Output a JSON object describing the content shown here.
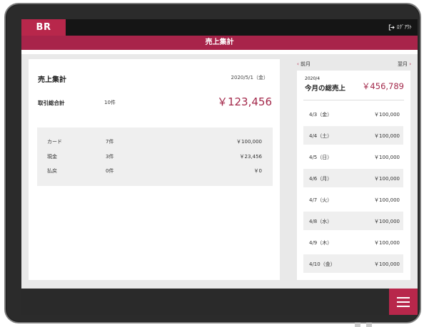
{
  "app": {
    "logo": "BR",
    "logout_label": "ﾛｸﾞｱｳﾄ",
    "screen_title": "売上集計"
  },
  "summary": {
    "title": "売上集計",
    "date": "2020/5/1（金）",
    "total_label": "取引総合計",
    "total_count": "10件",
    "total_amount": "￥123,456",
    "breakdown": [
      {
        "label": "カード",
        "count": "7件",
        "amount": "￥100,000"
      },
      {
        "label": "現金",
        "count": "3件",
        "amount": "￥23,456"
      },
      {
        "label": "払戻",
        "count": "0件",
        "amount": "￥0"
      }
    ]
  },
  "month": {
    "prev_label": "前月",
    "next_label": "翌月",
    "year_month": "2020/4",
    "title": "今月の総売上",
    "total_amount": "￥456,789",
    "days": [
      {
        "date": "4/3（金）",
        "amount": "￥100,000"
      },
      {
        "date": "4/4（土）",
        "amount": "￥100,000"
      },
      {
        "date": "4/5（日）",
        "amount": "￥100,000"
      },
      {
        "date": "4/6（月）",
        "amount": "￥100,000"
      },
      {
        "date": "4/7（火）",
        "amount": "￥100,000"
      },
      {
        "date": "4/8（水）",
        "amount": "￥100,000"
      },
      {
        "date": "4/9（木）",
        "amount": "￥100,000"
      },
      {
        "date": "4/10（金）",
        "amount": "￥100,000"
      }
    ]
  },
  "colors": {
    "accent": "#b8274b",
    "title_bar": "#a8244a",
    "dark": "#151515"
  },
  "icons": {
    "logout": "logout-icon",
    "menu": "hamburger-menu-icon",
    "prev": "chevron-left-icon",
    "next": "chevron-right-icon"
  }
}
